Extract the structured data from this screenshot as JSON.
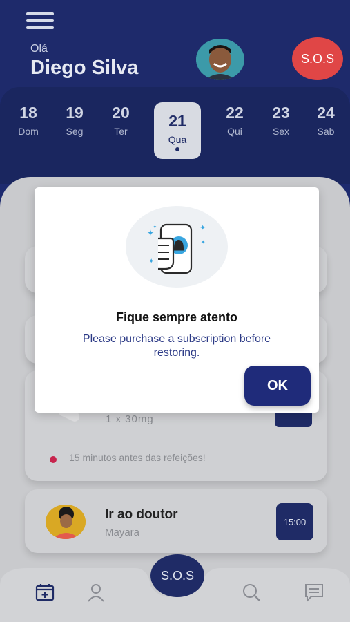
{
  "header": {
    "greeting": "Olá",
    "user_name": "Diego Silva",
    "sos_label": "S.O.S"
  },
  "calendar": {
    "days": [
      {
        "num": "18",
        "weekday": "Dom"
      },
      {
        "num": "19",
        "weekday": "Seg"
      },
      {
        "num": "20",
        "weekday": "Ter"
      },
      {
        "num": "21",
        "weekday": "Qua"
      },
      {
        "num": "22",
        "weekday": "Qui"
      },
      {
        "num": "23",
        "weekday": "Sex"
      },
      {
        "num": "24",
        "weekday": "Sab"
      }
    ],
    "selected_index": 3
  },
  "medication": {
    "dose": "1 x 30mg",
    "note": "15 minutos antes das refeições!"
  },
  "appointment": {
    "title": "Ir ao doutor",
    "subtitle": "Mayara",
    "time": "15:00"
  },
  "bottom_nav": {
    "sos_label": "S.O.S",
    "items": [
      "calendar-icon",
      "profile-icon",
      "search-icon",
      "chat-icon"
    ]
  },
  "dialog": {
    "title": "Fique sempre atento",
    "message": "Please purchase a subscription before restoring.",
    "ok_label": "OK"
  },
  "colors": {
    "primary": "#1f2b66",
    "sos_red": "#e04646",
    "accent_blue": "#2c3a86",
    "note_dot": "#c7244d"
  }
}
